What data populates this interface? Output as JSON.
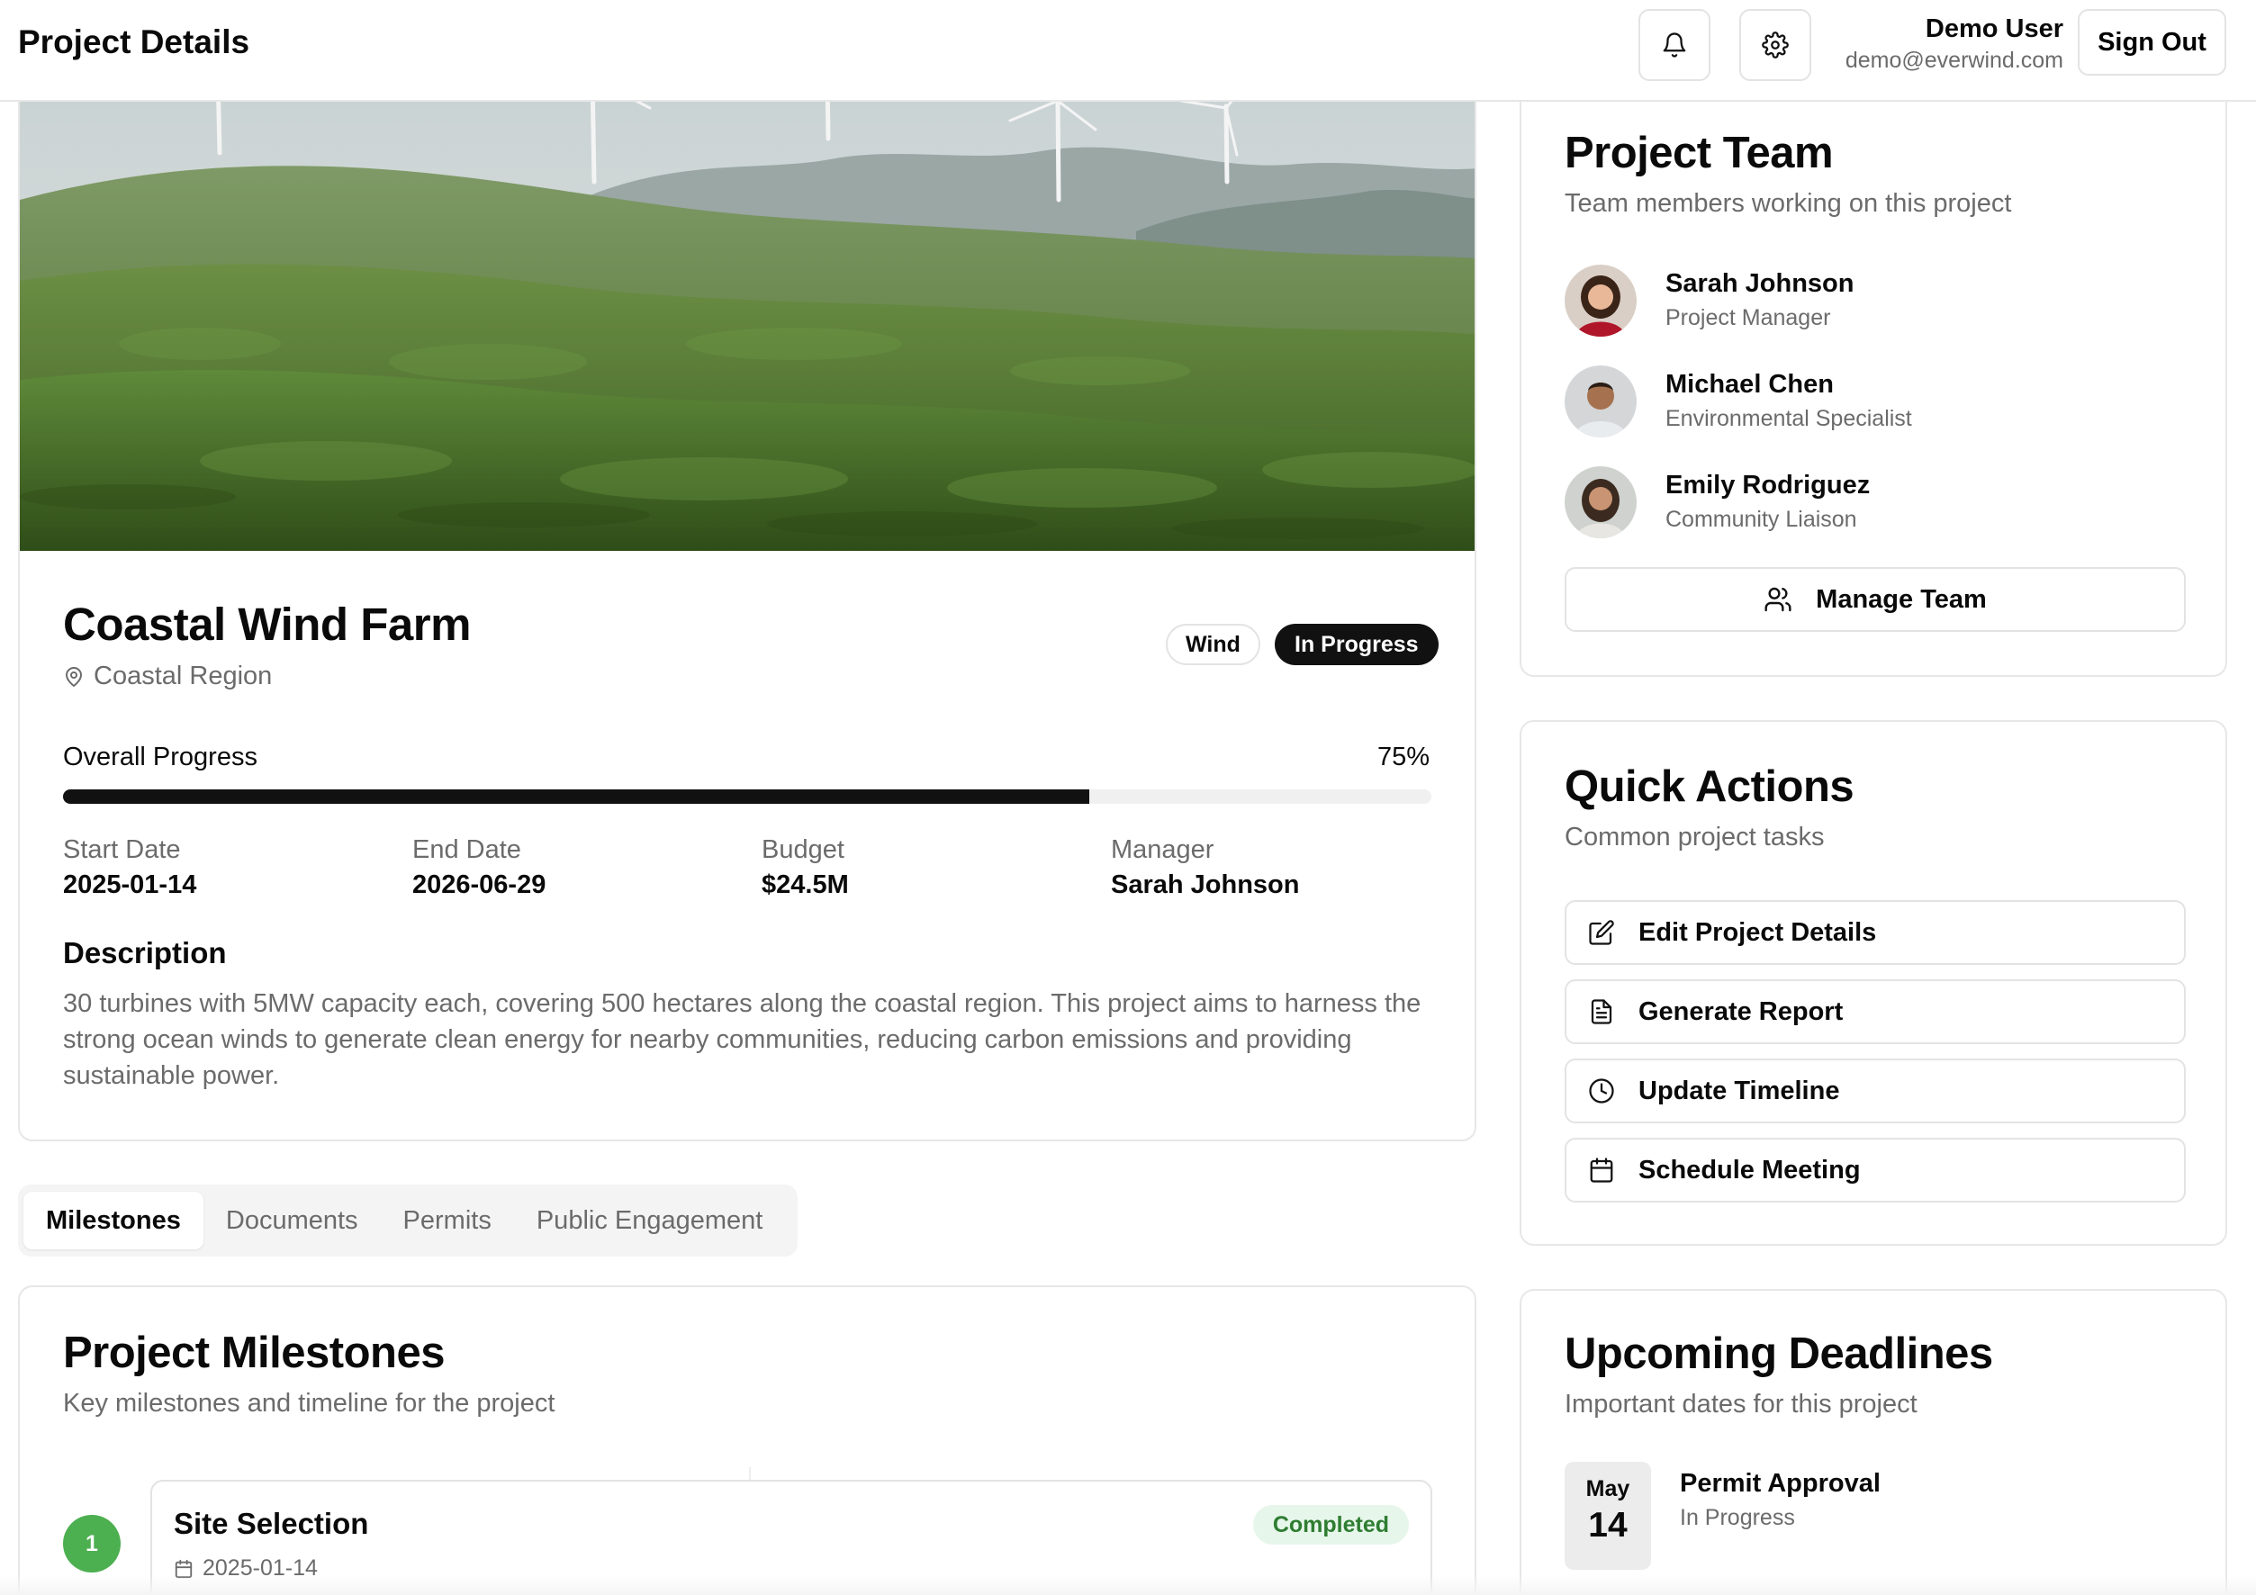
{
  "header": {
    "title": "Project Details",
    "user_name": "Demo User",
    "user_email": "demo@everwind.com",
    "sign_out_label": "Sign Out"
  },
  "project": {
    "name": "Coastal Wind Farm",
    "location": "Coastal Region",
    "type_badge": "Wind",
    "status_badge": "In Progress",
    "progress_label": "Overall Progress",
    "progress_value": "75%",
    "progress_fraction": 0.75,
    "meta": [
      {
        "label": "Start Date",
        "value": "2025-01-14"
      },
      {
        "label": "End Date",
        "value": "2026-06-29"
      },
      {
        "label": "Budget",
        "value": "$24.5M"
      },
      {
        "label": "Manager",
        "value": "Sarah Johnson"
      }
    ],
    "description_title": "Description",
    "description": "30 turbines with 5MW capacity each, covering 500 hectares along the coastal region. This project aims to harness the strong ocean winds to generate clean energy for nearby communities, reducing carbon emissions and providing sustainable power."
  },
  "tabs": [
    {
      "label": "Milestones",
      "active": true
    },
    {
      "label": "Documents",
      "active": false
    },
    {
      "label": "Permits",
      "active": false
    },
    {
      "label": "Public Engagement",
      "active": false
    }
  ],
  "milestones": {
    "title": "Project Milestones",
    "subtitle": "Key milestones and timeline for the project",
    "items": [
      {
        "number": "1",
        "title": "Site Selection",
        "date": "2025-01-14",
        "status": "Completed"
      }
    ]
  },
  "team": {
    "title": "Project Team",
    "subtitle": "Team members working on this project",
    "members": [
      {
        "name": "Sarah Johnson",
        "role": "Project Manager"
      },
      {
        "name": "Michael Chen",
        "role": "Environmental Specialist"
      },
      {
        "name": "Emily Rodriguez",
        "role": "Community Liaison"
      }
    ],
    "manage_label": "Manage Team"
  },
  "quick_actions": {
    "title": "Quick Actions",
    "subtitle": "Common project tasks",
    "actions": [
      {
        "label": "Edit Project Details",
        "icon": "edit-icon"
      },
      {
        "label": "Generate Report",
        "icon": "file-text-icon"
      },
      {
        "label": "Update Timeline",
        "icon": "clock-icon"
      },
      {
        "label": "Schedule Meeting",
        "icon": "calendar-icon"
      }
    ]
  },
  "deadlines": {
    "title": "Upcoming Deadlines",
    "subtitle": "Important dates for this project",
    "items": [
      {
        "month": "May",
        "day": "14",
        "title": "Permit Approval",
        "status": "In Progress"
      }
    ]
  },
  "colors": {
    "accent": "#111111",
    "completed_bg": "#e7f6ea",
    "completed_text": "#2e7d32",
    "milestone_dot": "#4caf50"
  }
}
